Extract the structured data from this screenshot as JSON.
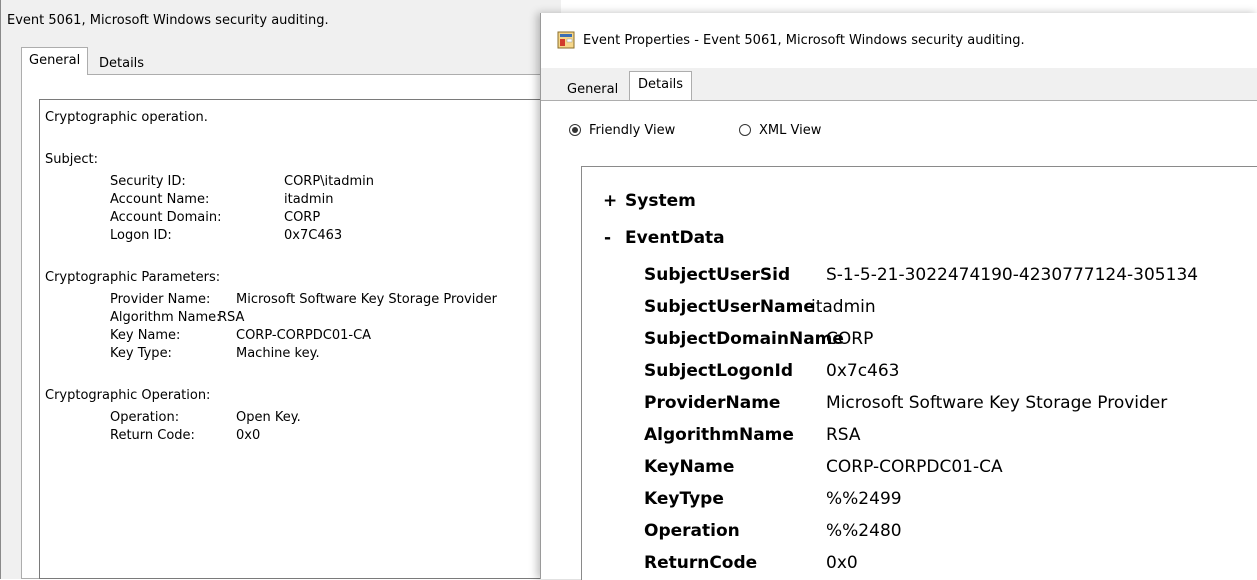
{
  "left_window": {
    "title": "Event 5061, Microsoft Windows security auditing.",
    "tabs": [
      {
        "label": "General",
        "active": true
      },
      {
        "label": "Details",
        "active": false
      }
    ],
    "description": {
      "heading": "Cryptographic operation.",
      "subject_label": "Subject:",
      "subject": [
        {
          "label": "Security ID:",
          "value": "CORP\\itadmin"
        },
        {
          "label": "Account Name:",
          "value": "itadmin"
        },
        {
          "label": "Account Domain:",
          "value": "CORP"
        },
        {
          "label": "Logon ID:",
          "value": "0x7C463"
        }
      ],
      "params_label": "Cryptographic Parameters:",
      "params": [
        {
          "label": "Provider Name:",
          "value": "Microsoft Software Key Storage Provider"
        },
        {
          "label": "Algorithm Name:",
          "value": "RSA"
        },
        {
          "label": "Key Name:",
          "value": "CORP-CORPDC01-CA"
        },
        {
          "label": "Key Type:",
          "value": "Machine key."
        }
      ],
      "operation_label": "Cryptographic Operation:",
      "operation": [
        {
          "label": "Operation:",
          "value": "Open Key."
        },
        {
          "label": "Return Code:",
          "value": "0x0"
        }
      ]
    }
  },
  "right_window": {
    "title": "Event Properties - Event 5061, Microsoft Windows security auditing.",
    "icon": "event-viewer-icon",
    "tabs": [
      {
        "label": "General",
        "active": false
      },
      {
        "label": "Details",
        "active": true
      }
    ],
    "view_options": {
      "friendly_label": "Friendly View",
      "xml_label": "XML View",
      "selected": "Friendly View"
    },
    "tree": {
      "system_toggle": "+",
      "system_label": "System",
      "eventdata_toggle": "-",
      "eventdata_label": "EventData",
      "fields": [
        {
          "key": "SubjectUserSid",
          "value": "S-1-5-21-3022474190-4230777124-305134"
        },
        {
          "key": "SubjectUserName",
          "value": "itadmin"
        },
        {
          "key": "SubjectDomainName",
          "value": "CORP"
        },
        {
          "key": "SubjectLogonId",
          "value": "0x7c463"
        },
        {
          "key": "ProviderName",
          "value": "Microsoft Software Key Storage Provider"
        },
        {
          "key": "AlgorithmName",
          "value": "RSA"
        },
        {
          "key": "KeyName",
          "value": "CORP-CORPDC01-CA"
        },
        {
          "key": "KeyType",
          "value": "%%2499"
        },
        {
          "key": "Operation",
          "value": "%%2480"
        },
        {
          "key": "ReturnCode",
          "value": "0x0"
        }
      ]
    }
  }
}
